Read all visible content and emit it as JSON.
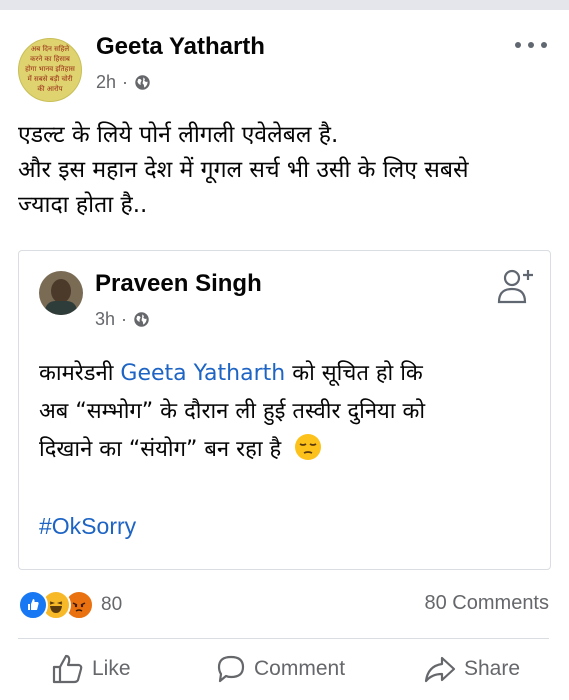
{
  "post": {
    "author": "Geeta Yatharth",
    "time": "2h",
    "avatar_text": [
      "अब दिन सहिले",
      "करने का हिसाब",
      "होगा भानव इतिहास",
      "में सबसे बड़ी चोरी",
      "की आरोप"
    ],
    "text_lines": [
      "एडल्ट के लिये पोर्न लीगली एवेलेबल है.",
      "और इस महान देश में गूगल सर्च भी उसी के लिए सबसे",
      "ज्यादा होता है.."
    ]
  },
  "shared": {
    "author": "Praveen Singh",
    "time": "3h",
    "line1_prefix": "कामरेडनी ",
    "mention": "Geeta Yatharth",
    "line1_suffix": "  को सूचित हो कि",
    "line2": "अब “सम्भोग” के दौरान ली हुई तस्वीर दुनिया को",
    "line3": "दिखाने का “संयोग” बन रहा है",
    "hashtag": "#OkSorry"
  },
  "stats": {
    "reaction_count": "80",
    "comments": "80 Comments"
  },
  "actions": {
    "like": "Like",
    "comment": "Comment",
    "share": "Share"
  },
  "colors": {
    "link": "#1d64c4",
    "secondary_text": "#65676b",
    "like_blue": "#1877f2"
  },
  "icons": [
    "globe-icon",
    "more-icon",
    "add-friend-icon",
    "like-reaction-icon",
    "haha-reaction-icon",
    "angry-reaction-icon",
    "pensive-emoji-icon",
    "thumbs-up-icon",
    "comment-icon",
    "share-icon"
  ]
}
